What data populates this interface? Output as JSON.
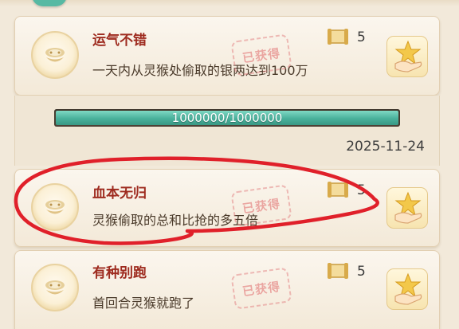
{
  "achievements": [
    {
      "title": "运气不错",
      "description": "一天内从灵猴处偷取的银两达到100万",
      "reward_count": "5",
      "stamp_text": "已获得",
      "medal_icon": "monkey-medal-icon",
      "claim_icon": "hand-star-icon"
    },
    {
      "title": "血本无归",
      "description": "灵猴偷取的总和比抢的多五倍",
      "reward_count": "5",
      "stamp_text": "已获得",
      "medal_icon": "monkey-medal-icon",
      "claim_icon": "hand-star-icon"
    },
    {
      "title": "有种别跑",
      "description": "首回合灵猴就跑了",
      "reward_count": "5",
      "stamp_text": "已获得",
      "medal_icon": "monkey-medal-icon",
      "claim_icon": "hand-star-icon"
    }
  ],
  "progress": {
    "text": "1000000/1000000",
    "fraction": 1.0
  },
  "date": "2025-11-24",
  "colors": {
    "title": "#9e2b1f",
    "progress": "#49b09b",
    "annotation": "#e0202a"
  }
}
